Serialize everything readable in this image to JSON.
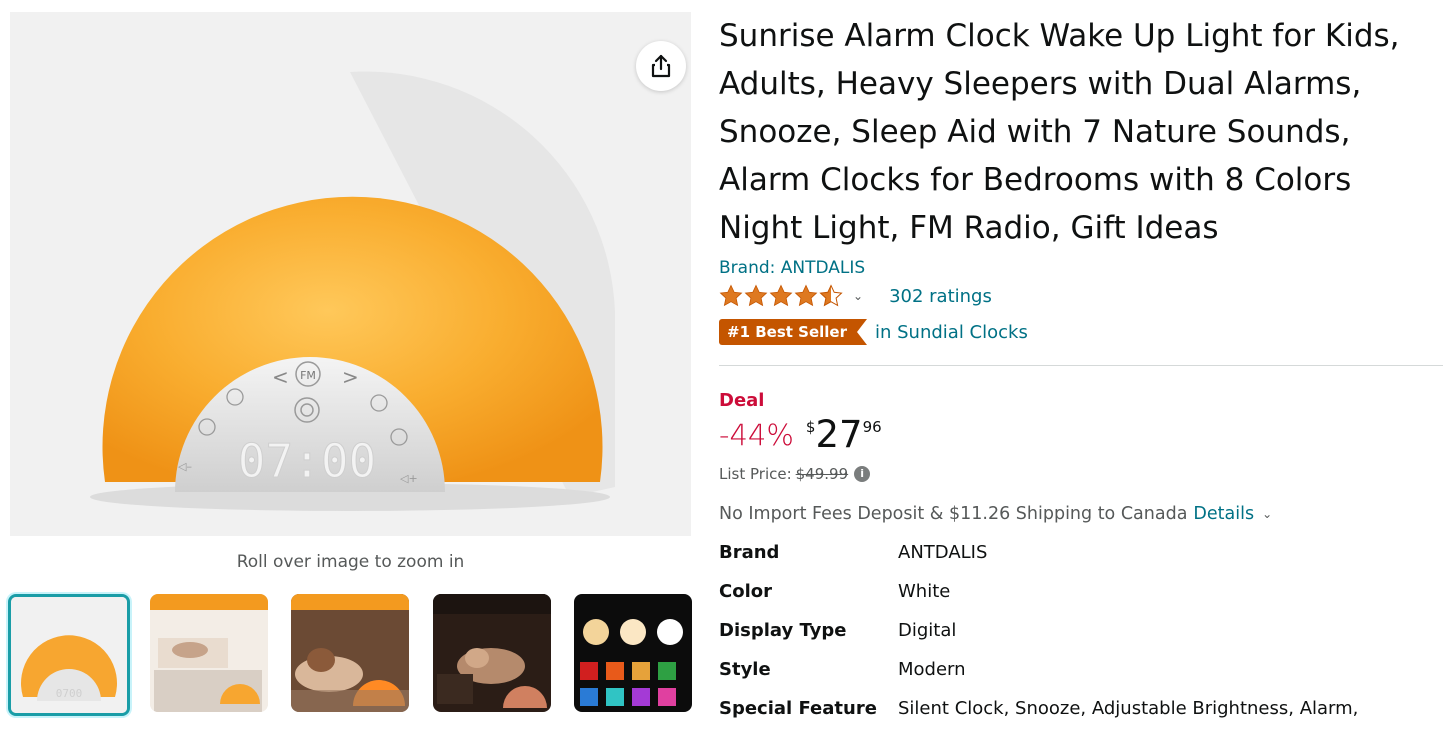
{
  "media": {
    "zoom_hint": "Roll over image to zoom in",
    "clock_display": "07:00",
    "thumbnails": [
      {
        "name": "thumb-main-product"
      },
      {
        "name": "thumb-wake-up-feature"
      },
      {
        "name": "thumb-snooze-feature"
      },
      {
        "name": "thumb-night-light-feature"
      },
      {
        "name": "thumb-color-lights"
      }
    ]
  },
  "product": {
    "title": "Sunrise Alarm Clock Wake Up Light for Kids, Adults, Heavy Sleepers with Dual Alarms, Snooze, Sleep Aid with 7 Nature Sounds, Alarm Clocks for Bedrooms with 8 Colors Night Light, FM Radio, Gift Ideas",
    "brand_link": "Brand: ANTDALIS",
    "rating": 4.5,
    "ratings_count": "302 ratings",
    "badge": "#1 Best Seller",
    "badge_category": "in Sundial Clocks",
    "deal_label": "Deal",
    "discount": "-44%",
    "price_currency": "$",
    "price_whole": "27",
    "price_fraction": "96",
    "list_price_label": "List Price:",
    "list_price": "$49.99",
    "shipping_text": "No Import Fees Deposit & $11.26 Shipping to Canada",
    "details_link": "Details"
  },
  "specs": [
    {
      "key": "Brand",
      "value": "ANTDALIS"
    },
    {
      "key": "Color",
      "value": "White"
    },
    {
      "key": "Display Type",
      "value": "Digital"
    },
    {
      "key": "Style",
      "value": "Modern"
    },
    {
      "key": "Special Feature",
      "value": "Silent Clock, Snooze, Adjustable Brightness, Alarm,"
    }
  ],
  "colors": {
    "link": "#007185",
    "deal": "#cc0c39",
    "badge": "#c45500",
    "lamp_orange": "#f5a623"
  }
}
